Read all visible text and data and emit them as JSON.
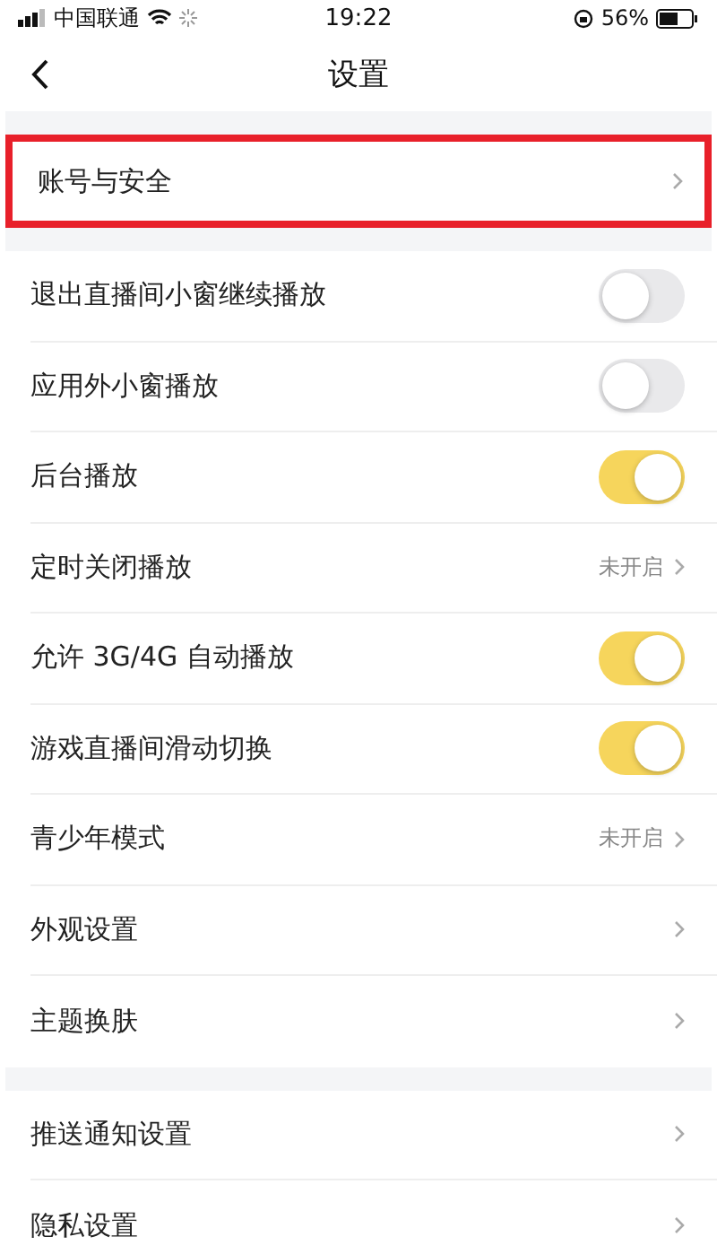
{
  "status_bar": {
    "carrier": "中国联通",
    "time": "19:22",
    "battery": "56%"
  },
  "nav": {
    "title": "设置"
  },
  "account": {
    "label": "账号与安全",
    "highlighted": true
  },
  "groups": [
    {
      "items": [
        {
          "kind": "toggle",
          "label": "退出直播间小窗继续播放",
          "on": false
        },
        {
          "kind": "toggle",
          "label": "应用外小窗播放",
          "on": false
        },
        {
          "kind": "toggle",
          "label": "后台播放",
          "on": true
        },
        {
          "kind": "link",
          "label": "定时关闭播放",
          "value": "未开启"
        },
        {
          "kind": "toggle",
          "label": "允许 3G/4G 自动播放",
          "on": true
        },
        {
          "kind": "toggle",
          "label": "游戏直播间滑动切换",
          "on": true
        },
        {
          "kind": "link",
          "label": "青少年模式",
          "value": "未开启"
        },
        {
          "kind": "link",
          "label": "外观设置"
        },
        {
          "kind": "link",
          "label": "主题换肤"
        }
      ]
    },
    {
      "items": [
        {
          "kind": "link",
          "label": "推送通知设置"
        },
        {
          "kind": "link",
          "label": "隐私设置"
        }
      ]
    }
  ]
}
